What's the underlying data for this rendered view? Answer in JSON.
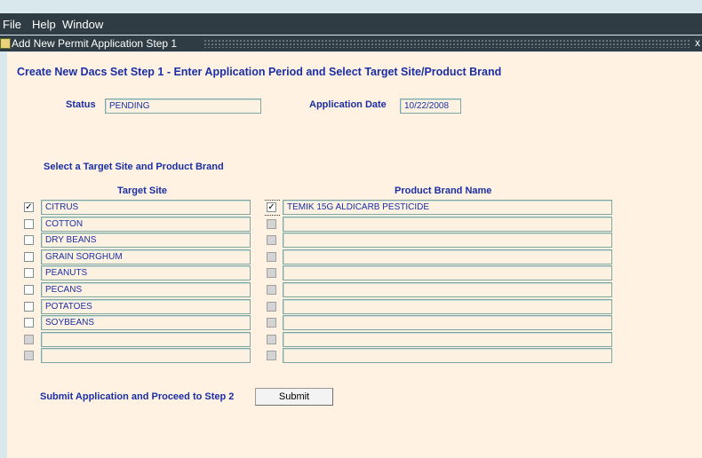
{
  "menu": {
    "file": "File",
    "help": "Help",
    "window": "Window"
  },
  "window": {
    "title": "Add New Permit Application Step 1",
    "close": "x"
  },
  "heading": "Create New Dacs Set Step 1 - Enter Application Period and Select Target Site/Product Brand",
  "status": {
    "label": "Status",
    "value": "PENDING"
  },
  "application_date": {
    "label": "Application Date",
    "value": "10/22/2008"
  },
  "select_prompt": "Select a Target Site and Product Brand",
  "columns": {
    "target_site": "Target Site",
    "product_brand": "Product Brand Name"
  },
  "rows": [
    {
      "site": "CITRUS",
      "site_checked": true,
      "site_enabled": true,
      "product": "TEMIK 15G ALDICARB PESTICIDE",
      "product_checked": true,
      "product_enabled": true
    },
    {
      "site": "COTTON",
      "site_checked": false,
      "site_enabled": true,
      "product": "",
      "product_checked": false,
      "product_enabled": false
    },
    {
      "site": "DRY BEANS",
      "site_checked": false,
      "site_enabled": true,
      "product": "",
      "product_checked": false,
      "product_enabled": false
    },
    {
      "site": "GRAIN SORGHUM",
      "site_checked": false,
      "site_enabled": true,
      "product": "",
      "product_checked": false,
      "product_enabled": false
    },
    {
      "site": "PEANUTS",
      "site_checked": false,
      "site_enabled": true,
      "product": "",
      "product_checked": false,
      "product_enabled": false
    },
    {
      "site": "PECANS",
      "site_checked": false,
      "site_enabled": true,
      "product": "",
      "product_checked": false,
      "product_enabled": false
    },
    {
      "site": "POTATOES",
      "site_checked": false,
      "site_enabled": true,
      "product": "",
      "product_checked": false,
      "product_enabled": false
    },
    {
      "site": "SOYBEANS",
      "site_checked": false,
      "site_enabled": true,
      "product": "",
      "product_checked": false,
      "product_enabled": false
    },
    {
      "site": "",
      "site_checked": false,
      "site_enabled": false,
      "product": "",
      "product_checked": false,
      "product_enabled": false
    },
    {
      "site": "",
      "site_checked": false,
      "site_enabled": false,
      "product": "",
      "product_checked": false,
      "product_enabled": false
    }
  ],
  "submit": {
    "prompt": "Submit Application and Proceed to Step 2",
    "button": "Submit"
  },
  "colors": {
    "accent": "#1a2ea5",
    "panel": "#fff2e2",
    "chrome": "#2f3c43",
    "field_border": "#7fa6a0"
  },
  "icons": {
    "window": "form-window-icon",
    "checkmark": "checkmark-icon"
  }
}
